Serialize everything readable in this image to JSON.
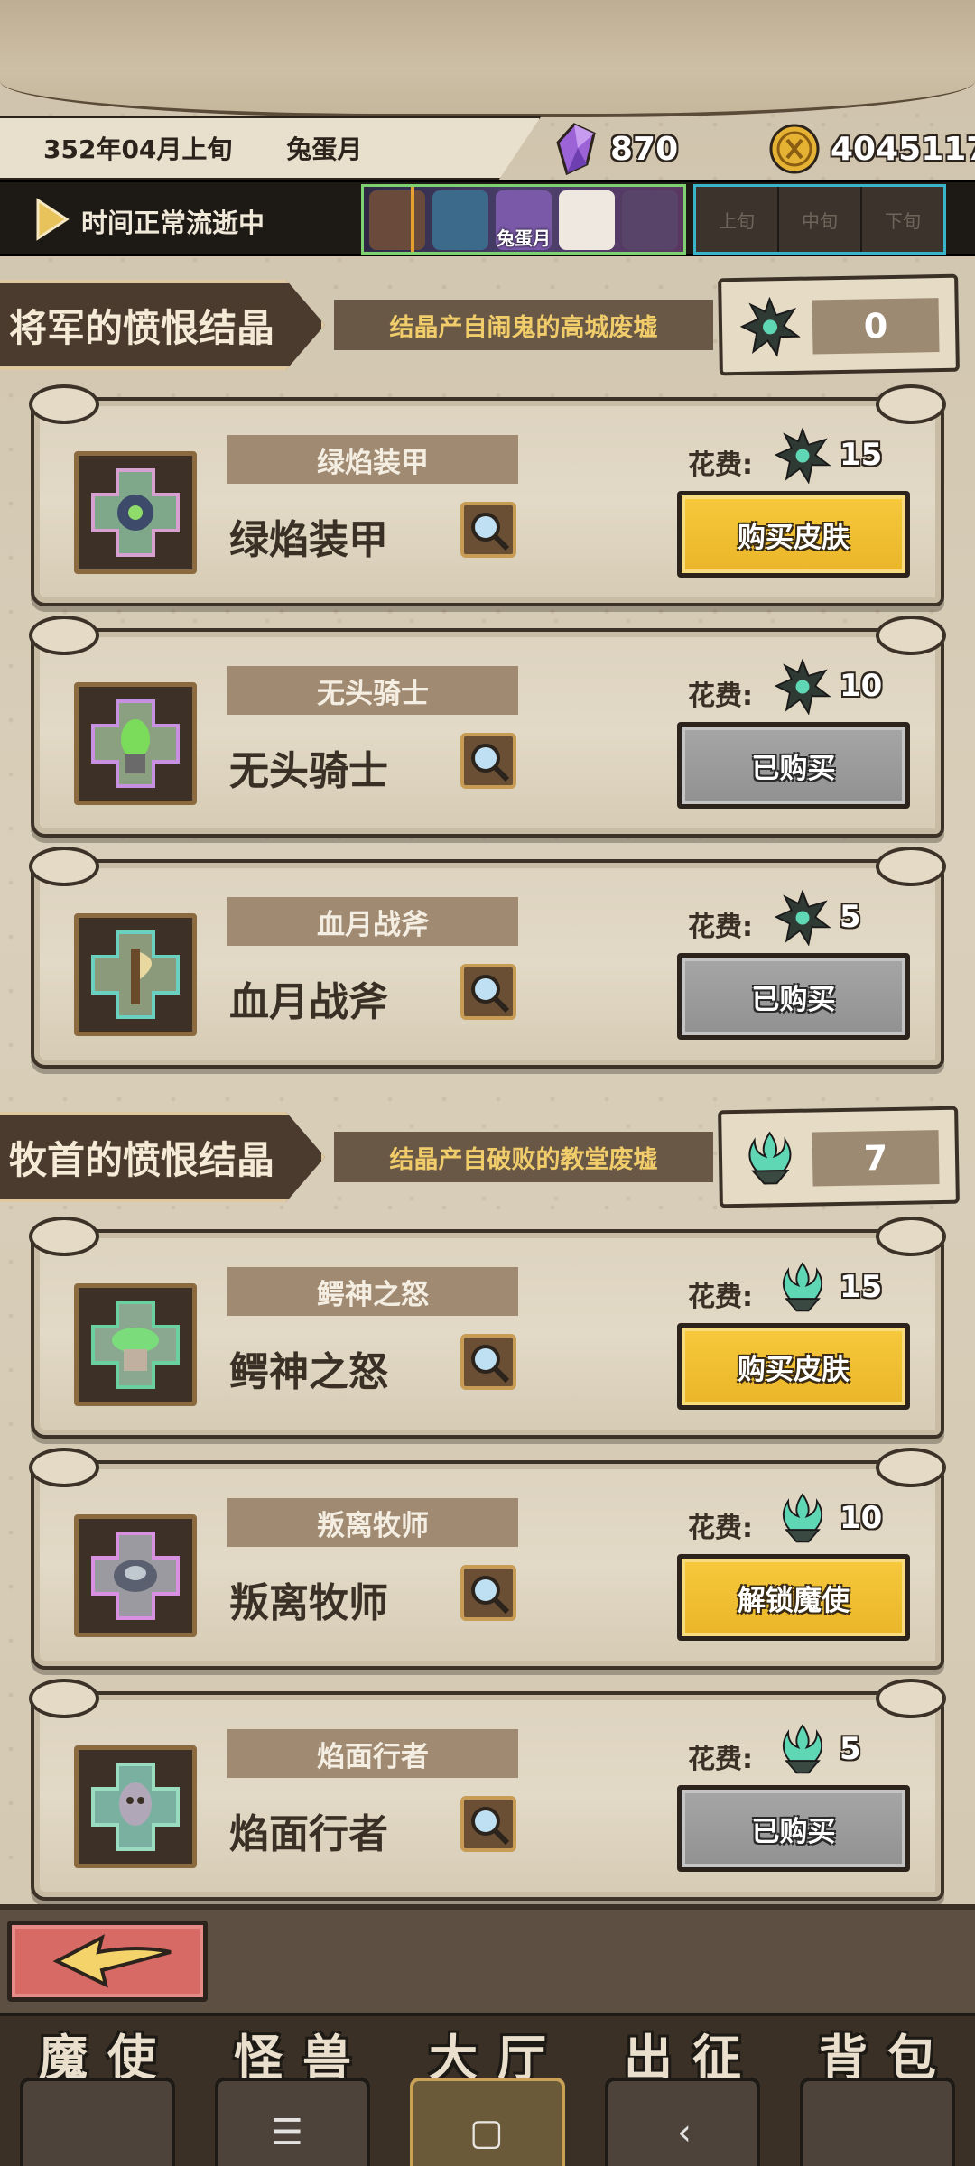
{
  "header": {
    "date": "352年04月上旬",
    "month_name": "兔蛋月",
    "gems": "870",
    "coins": "4045117",
    "status": "时间正常流逝中",
    "month_strip_label": "兔蛋月",
    "periods": [
      "上旬",
      "中旬",
      "下旬"
    ]
  },
  "sections": [
    {
      "title": "将军的愤恨结晶",
      "subtitle": "结晶产自闹鬼的高城废墟",
      "crystal_count": "0",
      "crystal_icon": "dark-spiky-crystal-icon",
      "items": [
        {
          "badge": "绿焰装甲",
          "name": "绿焰装甲",
          "cost_label": "花费:",
          "cost": "15",
          "button": "购买皮肤",
          "state": "buy"
        },
        {
          "badge": "无头骑士",
          "name": "无头骑士",
          "cost_label": "花费:",
          "cost": "10",
          "button": "已购买",
          "state": "owned"
        },
        {
          "badge": "血月战斧",
          "name": "血月战斧",
          "cost_label": "花费:",
          "cost": "5",
          "button": "已购买",
          "state": "owned"
        }
      ]
    },
    {
      "title": "牧首的愤恨结晶",
      "subtitle": "结晶产自破败的教堂废墟",
      "crystal_count": "7",
      "crystal_icon": "teal-flame-crystal-icon",
      "items": [
        {
          "badge": "鳄神之怒",
          "name": "鳄神之怒",
          "cost_label": "花费:",
          "cost": "15",
          "button": "购买皮肤",
          "state": "buy"
        },
        {
          "badge": "叛离牧师",
          "name": "叛离牧师",
          "cost_label": "花费:",
          "cost": "10",
          "button": "解锁魔使",
          "state": "buy"
        },
        {
          "badge": "焰面行者",
          "name": "焰面行者",
          "cost_label": "花费:",
          "cost": "5",
          "button": "已购买",
          "state": "owned"
        }
      ]
    }
  ],
  "nav": {
    "items": [
      "魔使",
      "怪兽",
      "大厅",
      "出征",
      "背包"
    ],
    "active": "大厅"
  },
  "colors": {
    "accent_yellow": "#f2c236",
    "owned_grey": "#9e9e9e",
    "back_red": "#d86a66",
    "teal_crystal": "#5fd6b4"
  }
}
